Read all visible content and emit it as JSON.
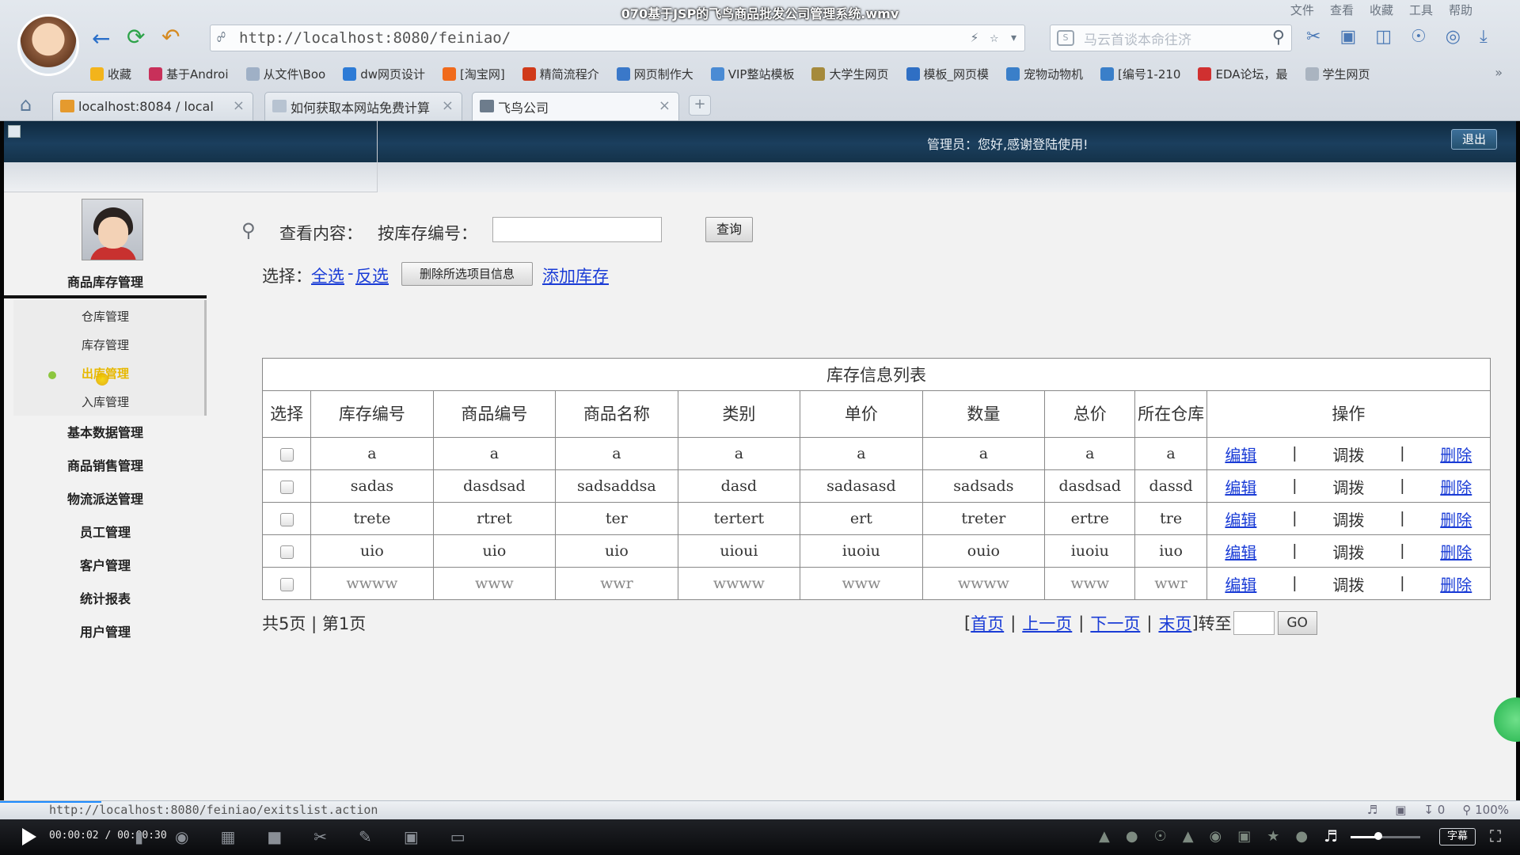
{
  "video_title": "070基于JSP的飞鸟商品批发公司管理系统.wmv",
  "browser": {
    "menu": [
      "文件",
      "查看",
      "收藏",
      "工具",
      "帮助"
    ],
    "address": "http://localhost:8080/feiniao/",
    "search_placeholder": "马云首谈本命往济",
    "bookmarks": [
      {
        "label": "收藏",
        "color": "#f3b41b"
      },
      {
        "label": "基于Androi",
        "color": "#c8305a"
      },
      {
        "label": "从文件\\Boo",
        "color": "#9fb0c6"
      },
      {
        "label": "dw网页设计",
        "color": "#2d7bd6"
      },
      {
        "label": "[淘宝网]",
        "color": "#f06a1c"
      },
      {
        "label": "精简流程介",
        "color": "#d03a1a"
      },
      {
        "label": "网页制作大",
        "color": "#3a78c9"
      },
      {
        "label": "VIP整站模板",
        "color": "#4a8bd4"
      },
      {
        "label": "大学生网页",
        "color": "#a58a3c"
      },
      {
        "label": "模板_网页模",
        "color": "#2f6fc4"
      },
      {
        "label": "宠物动物机",
        "color": "#3a7fc9"
      },
      {
        "label": "[编号1-210",
        "color": "#3a7fc9"
      },
      {
        "label": "EDA论坛，最",
        "color": "#d03030"
      },
      {
        "label": "学生网页",
        "color": "#aab4c0"
      }
    ],
    "tabs": [
      {
        "label": "localhost:8084 / local",
        "color": "#e59a2e"
      },
      {
        "label": "如何获取本网站免费计算",
        "color": "#b7c3d1"
      },
      {
        "label": "飞鸟公司",
        "color": "#6d7c8c"
      }
    ]
  },
  "header": {
    "welcome": "管理员：您好,感谢登陆使用!",
    "logout": "退出"
  },
  "sidebar": {
    "inventory_header": "商品库存管理",
    "inventory_items": [
      "仓库管理",
      "库存管理",
      "出库管理",
      "入库管理"
    ],
    "active_item": "出库管理",
    "other_groups": [
      "基本数据管理",
      "商品销售管理",
      "物流派送管理",
      "员工管理",
      "客户管理",
      "统计报表",
      "用户管理"
    ]
  },
  "search": {
    "view_label": "查看内容：",
    "by_label": "按库存编号：",
    "input_value": "",
    "query_button": "查询"
  },
  "actions": {
    "select_label": "选择：",
    "select_all": "全选",
    "dash": "-",
    "invert": "反选",
    "delete_selected": "删除所选项目信息",
    "add_stock": "添加库存"
  },
  "table": {
    "caption": "库存信息列表",
    "columns": [
      "选择",
      "库存编号",
      "商品编号",
      "商品名称",
      "类别",
      "单价",
      "数量",
      "总价",
      "所在仓库",
      "操作"
    ],
    "rows": [
      [
        "a",
        "a",
        "a",
        "a",
        "a",
        "a",
        "a",
        "a"
      ],
      [
        "sadas",
        "dasdsad",
        "sadsaddsa",
        "dasd",
        "sadasasd",
        "sadsads",
        "dasdsad",
        "dassd"
      ],
      [
        "trete",
        "rtret",
        "ter",
        "tertert",
        "ert",
        "treter",
        "ertre",
        "tre"
      ],
      [
        "uio",
        "uio",
        "uio",
        "uioui",
        "iuoiu",
        "ouio",
        "iuoiu",
        "iuo"
      ],
      [
        "wwww",
        "www",
        "wwr",
        "wwww",
        "www",
        "wwww",
        "www",
        "wwr"
      ]
    ],
    "ops": {
      "edit": "编辑",
      "sep": "|",
      "transfer": "调拨",
      "delete": "删除"
    }
  },
  "pager": {
    "total": "共5页",
    "sep": "|",
    "current": "第1页",
    "nav": {
      "open": "[",
      "first": "首页",
      "prev": "上一页",
      "next": "下一页",
      "last": "末页",
      "close": "]",
      "goto": "转至",
      "go": "GO"
    }
  },
  "status_bar": {
    "url": "http://localhost:8080/feiniao/exitslist.action",
    "count": "0",
    "zoom": "100%"
  },
  "player": {
    "time": "00:00:02 / 00:00:30",
    "subtitle": "字幕",
    "volume_level": 0.4
  }
}
